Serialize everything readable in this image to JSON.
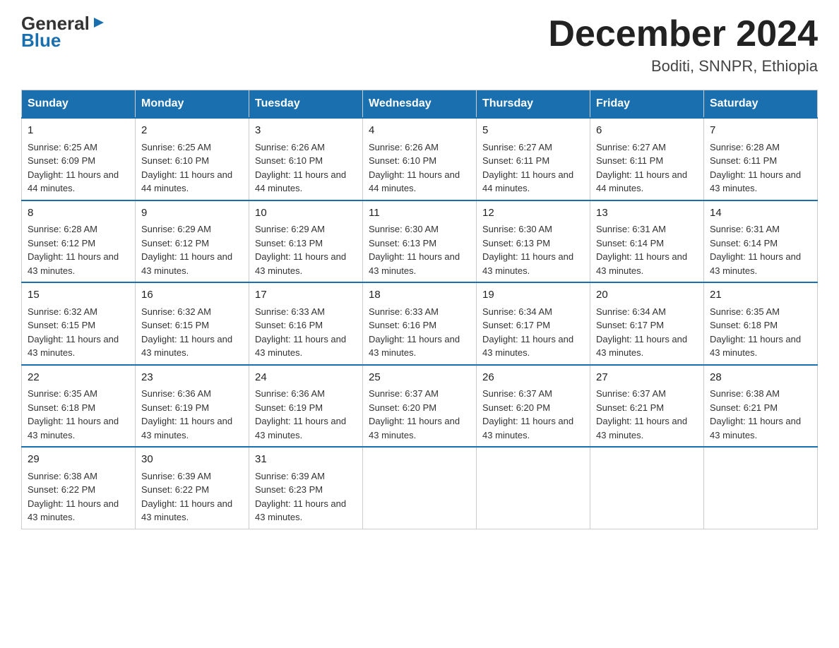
{
  "logo": {
    "part1": "General",
    "part2": "Blue"
  },
  "title": "December 2024",
  "subtitle": "Boditi, SNNPR, Ethiopia",
  "days_of_week": [
    "Sunday",
    "Monday",
    "Tuesday",
    "Wednesday",
    "Thursday",
    "Friday",
    "Saturday"
  ],
  "weeks": [
    [
      {
        "day": "1",
        "sunrise": "6:25 AM",
        "sunset": "6:09 PM",
        "daylight": "11 hours and 44 minutes."
      },
      {
        "day": "2",
        "sunrise": "6:25 AM",
        "sunset": "6:10 PM",
        "daylight": "11 hours and 44 minutes."
      },
      {
        "day": "3",
        "sunrise": "6:26 AM",
        "sunset": "6:10 PM",
        "daylight": "11 hours and 44 minutes."
      },
      {
        "day": "4",
        "sunrise": "6:26 AM",
        "sunset": "6:10 PM",
        "daylight": "11 hours and 44 minutes."
      },
      {
        "day": "5",
        "sunrise": "6:27 AM",
        "sunset": "6:11 PM",
        "daylight": "11 hours and 44 minutes."
      },
      {
        "day": "6",
        "sunrise": "6:27 AM",
        "sunset": "6:11 PM",
        "daylight": "11 hours and 44 minutes."
      },
      {
        "day": "7",
        "sunrise": "6:28 AM",
        "sunset": "6:11 PM",
        "daylight": "11 hours and 43 minutes."
      }
    ],
    [
      {
        "day": "8",
        "sunrise": "6:28 AM",
        "sunset": "6:12 PM",
        "daylight": "11 hours and 43 minutes."
      },
      {
        "day": "9",
        "sunrise": "6:29 AM",
        "sunset": "6:12 PM",
        "daylight": "11 hours and 43 minutes."
      },
      {
        "day": "10",
        "sunrise": "6:29 AM",
        "sunset": "6:13 PM",
        "daylight": "11 hours and 43 minutes."
      },
      {
        "day": "11",
        "sunrise": "6:30 AM",
        "sunset": "6:13 PM",
        "daylight": "11 hours and 43 minutes."
      },
      {
        "day": "12",
        "sunrise": "6:30 AM",
        "sunset": "6:13 PM",
        "daylight": "11 hours and 43 minutes."
      },
      {
        "day": "13",
        "sunrise": "6:31 AM",
        "sunset": "6:14 PM",
        "daylight": "11 hours and 43 minutes."
      },
      {
        "day": "14",
        "sunrise": "6:31 AM",
        "sunset": "6:14 PM",
        "daylight": "11 hours and 43 minutes."
      }
    ],
    [
      {
        "day": "15",
        "sunrise": "6:32 AM",
        "sunset": "6:15 PM",
        "daylight": "11 hours and 43 minutes."
      },
      {
        "day": "16",
        "sunrise": "6:32 AM",
        "sunset": "6:15 PM",
        "daylight": "11 hours and 43 minutes."
      },
      {
        "day": "17",
        "sunrise": "6:33 AM",
        "sunset": "6:16 PM",
        "daylight": "11 hours and 43 minutes."
      },
      {
        "day": "18",
        "sunrise": "6:33 AM",
        "sunset": "6:16 PM",
        "daylight": "11 hours and 43 minutes."
      },
      {
        "day": "19",
        "sunrise": "6:34 AM",
        "sunset": "6:17 PM",
        "daylight": "11 hours and 43 minutes."
      },
      {
        "day": "20",
        "sunrise": "6:34 AM",
        "sunset": "6:17 PM",
        "daylight": "11 hours and 43 minutes."
      },
      {
        "day": "21",
        "sunrise": "6:35 AM",
        "sunset": "6:18 PM",
        "daylight": "11 hours and 43 minutes."
      }
    ],
    [
      {
        "day": "22",
        "sunrise": "6:35 AM",
        "sunset": "6:18 PM",
        "daylight": "11 hours and 43 minutes."
      },
      {
        "day": "23",
        "sunrise": "6:36 AM",
        "sunset": "6:19 PM",
        "daylight": "11 hours and 43 minutes."
      },
      {
        "day": "24",
        "sunrise": "6:36 AM",
        "sunset": "6:19 PM",
        "daylight": "11 hours and 43 minutes."
      },
      {
        "day": "25",
        "sunrise": "6:37 AM",
        "sunset": "6:20 PM",
        "daylight": "11 hours and 43 minutes."
      },
      {
        "day": "26",
        "sunrise": "6:37 AM",
        "sunset": "6:20 PM",
        "daylight": "11 hours and 43 minutes."
      },
      {
        "day": "27",
        "sunrise": "6:37 AM",
        "sunset": "6:21 PM",
        "daylight": "11 hours and 43 minutes."
      },
      {
        "day": "28",
        "sunrise": "6:38 AM",
        "sunset": "6:21 PM",
        "daylight": "11 hours and 43 minutes."
      }
    ],
    [
      {
        "day": "29",
        "sunrise": "6:38 AM",
        "sunset": "6:22 PM",
        "daylight": "11 hours and 43 minutes."
      },
      {
        "day": "30",
        "sunrise": "6:39 AM",
        "sunset": "6:22 PM",
        "daylight": "11 hours and 43 minutes."
      },
      {
        "day": "31",
        "sunrise": "6:39 AM",
        "sunset": "6:23 PM",
        "daylight": "11 hours and 43 minutes."
      },
      null,
      null,
      null,
      null
    ]
  ]
}
